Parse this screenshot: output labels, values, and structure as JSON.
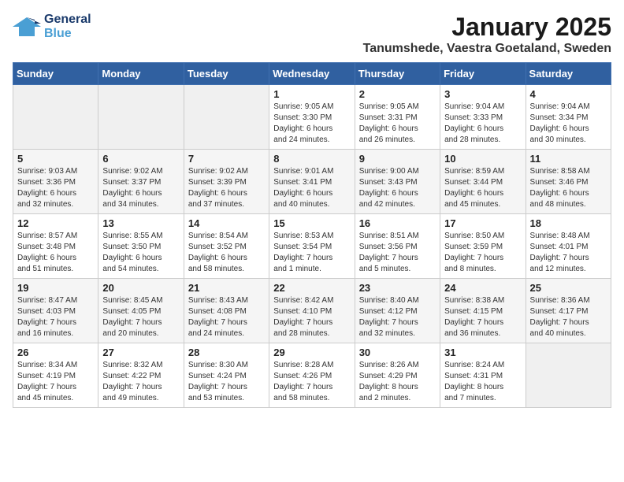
{
  "logo": {
    "line1": "General",
    "line2": "Blue"
  },
  "title": "January 2025",
  "subtitle": "Tanumshede, Vaestra Goetaland, Sweden",
  "days_of_week": [
    "Sunday",
    "Monday",
    "Tuesday",
    "Wednesday",
    "Thursday",
    "Friday",
    "Saturday"
  ],
  "weeks": [
    [
      {
        "day": "",
        "info": ""
      },
      {
        "day": "",
        "info": ""
      },
      {
        "day": "",
        "info": ""
      },
      {
        "day": "1",
        "info": "Sunrise: 9:05 AM\nSunset: 3:30 PM\nDaylight: 6 hours\nand 24 minutes."
      },
      {
        "day": "2",
        "info": "Sunrise: 9:05 AM\nSunset: 3:31 PM\nDaylight: 6 hours\nand 26 minutes."
      },
      {
        "day": "3",
        "info": "Sunrise: 9:04 AM\nSunset: 3:33 PM\nDaylight: 6 hours\nand 28 minutes."
      },
      {
        "day": "4",
        "info": "Sunrise: 9:04 AM\nSunset: 3:34 PM\nDaylight: 6 hours\nand 30 minutes."
      }
    ],
    [
      {
        "day": "5",
        "info": "Sunrise: 9:03 AM\nSunset: 3:36 PM\nDaylight: 6 hours\nand 32 minutes."
      },
      {
        "day": "6",
        "info": "Sunrise: 9:02 AM\nSunset: 3:37 PM\nDaylight: 6 hours\nand 34 minutes."
      },
      {
        "day": "7",
        "info": "Sunrise: 9:02 AM\nSunset: 3:39 PM\nDaylight: 6 hours\nand 37 minutes."
      },
      {
        "day": "8",
        "info": "Sunrise: 9:01 AM\nSunset: 3:41 PM\nDaylight: 6 hours\nand 40 minutes."
      },
      {
        "day": "9",
        "info": "Sunrise: 9:00 AM\nSunset: 3:43 PM\nDaylight: 6 hours\nand 42 minutes."
      },
      {
        "day": "10",
        "info": "Sunrise: 8:59 AM\nSunset: 3:44 PM\nDaylight: 6 hours\nand 45 minutes."
      },
      {
        "day": "11",
        "info": "Sunrise: 8:58 AM\nSunset: 3:46 PM\nDaylight: 6 hours\nand 48 minutes."
      }
    ],
    [
      {
        "day": "12",
        "info": "Sunrise: 8:57 AM\nSunset: 3:48 PM\nDaylight: 6 hours\nand 51 minutes."
      },
      {
        "day": "13",
        "info": "Sunrise: 8:55 AM\nSunset: 3:50 PM\nDaylight: 6 hours\nand 54 minutes."
      },
      {
        "day": "14",
        "info": "Sunrise: 8:54 AM\nSunset: 3:52 PM\nDaylight: 6 hours\nand 58 minutes."
      },
      {
        "day": "15",
        "info": "Sunrise: 8:53 AM\nSunset: 3:54 PM\nDaylight: 7 hours\nand 1 minute."
      },
      {
        "day": "16",
        "info": "Sunrise: 8:51 AM\nSunset: 3:56 PM\nDaylight: 7 hours\nand 5 minutes."
      },
      {
        "day": "17",
        "info": "Sunrise: 8:50 AM\nSunset: 3:59 PM\nDaylight: 7 hours\nand 8 minutes."
      },
      {
        "day": "18",
        "info": "Sunrise: 8:48 AM\nSunset: 4:01 PM\nDaylight: 7 hours\nand 12 minutes."
      }
    ],
    [
      {
        "day": "19",
        "info": "Sunrise: 8:47 AM\nSunset: 4:03 PM\nDaylight: 7 hours\nand 16 minutes."
      },
      {
        "day": "20",
        "info": "Sunrise: 8:45 AM\nSunset: 4:05 PM\nDaylight: 7 hours\nand 20 minutes."
      },
      {
        "day": "21",
        "info": "Sunrise: 8:43 AM\nSunset: 4:08 PM\nDaylight: 7 hours\nand 24 minutes."
      },
      {
        "day": "22",
        "info": "Sunrise: 8:42 AM\nSunset: 4:10 PM\nDaylight: 7 hours\nand 28 minutes."
      },
      {
        "day": "23",
        "info": "Sunrise: 8:40 AM\nSunset: 4:12 PM\nDaylight: 7 hours\nand 32 minutes."
      },
      {
        "day": "24",
        "info": "Sunrise: 8:38 AM\nSunset: 4:15 PM\nDaylight: 7 hours\nand 36 minutes."
      },
      {
        "day": "25",
        "info": "Sunrise: 8:36 AM\nSunset: 4:17 PM\nDaylight: 7 hours\nand 40 minutes."
      }
    ],
    [
      {
        "day": "26",
        "info": "Sunrise: 8:34 AM\nSunset: 4:19 PM\nDaylight: 7 hours\nand 45 minutes."
      },
      {
        "day": "27",
        "info": "Sunrise: 8:32 AM\nSunset: 4:22 PM\nDaylight: 7 hours\nand 49 minutes."
      },
      {
        "day": "28",
        "info": "Sunrise: 8:30 AM\nSunset: 4:24 PM\nDaylight: 7 hours\nand 53 minutes."
      },
      {
        "day": "29",
        "info": "Sunrise: 8:28 AM\nSunset: 4:26 PM\nDaylight: 7 hours\nand 58 minutes."
      },
      {
        "day": "30",
        "info": "Sunrise: 8:26 AM\nSunset: 4:29 PM\nDaylight: 8 hours\nand 2 minutes."
      },
      {
        "day": "31",
        "info": "Sunrise: 8:24 AM\nSunset: 4:31 PM\nDaylight: 8 hours\nand 7 minutes."
      },
      {
        "day": "",
        "info": ""
      }
    ]
  ]
}
